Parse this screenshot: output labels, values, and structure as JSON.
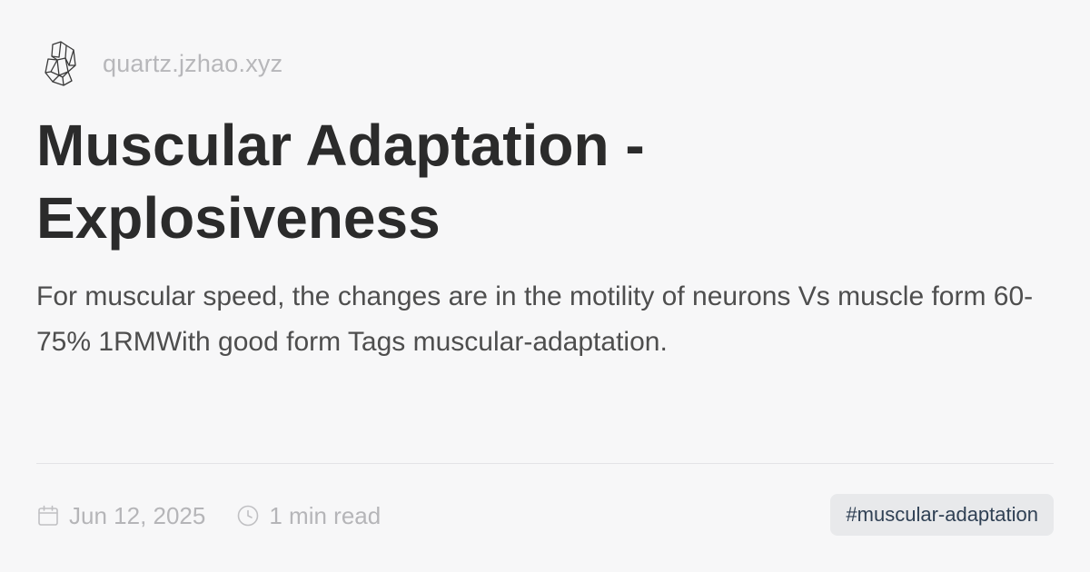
{
  "site": {
    "domain": "quartz.jzhao.xyz",
    "logo_icon": "crystal-logo-icon"
  },
  "article": {
    "title": "Muscular Adaptation - Explosiveness",
    "description": "For muscular speed, the changes are in the motility of neurons Vs muscle form 60-75% 1RMWith good form Tags muscular-adaptation.",
    "date": "Jun 12, 2025",
    "read_time": "1 min read",
    "tag": "#muscular-adaptation"
  },
  "icons": {
    "date": "calendar-icon",
    "read_time": "clock-icon"
  },
  "colors": {
    "background": "#f7f7f8",
    "title": "#2b2b2b",
    "muted": "#b5b5b8",
    "tag_background": "#e8e9eb",
    "tag_text": "#2f4054"
  }
}
